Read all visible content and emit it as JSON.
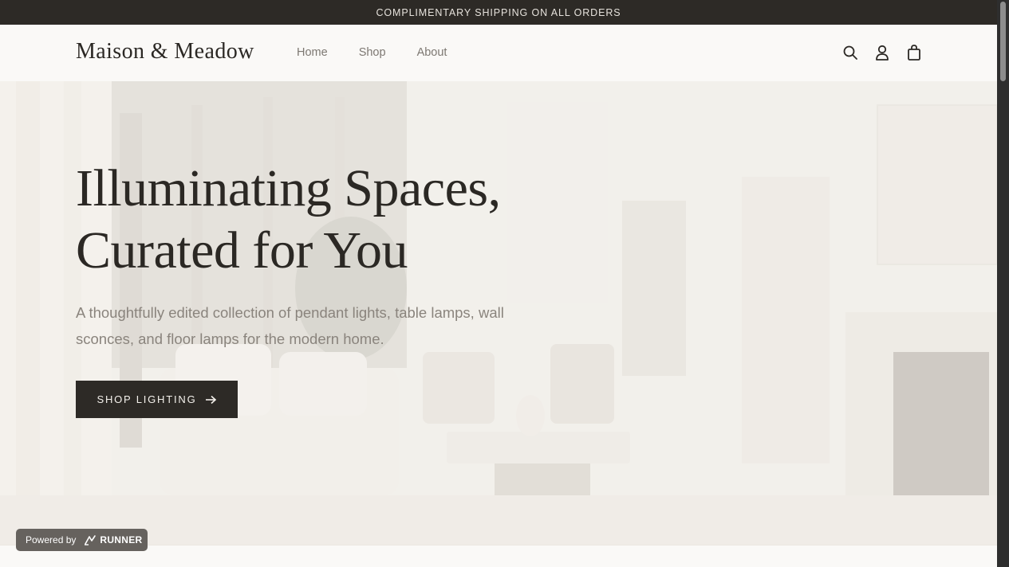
{
  "announcement": "COMPLIMENTARY SHIPPING ON ALL ORDERS",
  "header": {
    "logo": "Maison & Meadow",
    "nav": [
      "Home",
      "Shop",
      "About"
    ],
    "icons": [
      "search-icon",
      "account-icon",
      "cart-icon"
    ]
  },
  "hero": {
    "title_line1": "Illuminating Spaces,",
    "title_line2": "Curated for You",
    "subtitle": "A thoughtfully edited collection of pendant lights, table lamps, wall sconces, and floor lamps for the modern home.",
    "cta_label": "SHOP LIGHTING",
    "cta_icon": "arrow-right-icon"
  },
  "badge": {
    "prefix": "Powered by",
    "brand": "RUNNER",
    "icon": "runner-logo-icon"
  },
  "colors": {
    "dark": "#2d2a26",
    "background": "#f8f6f3",
    "muted_text": "#8a847d"
  }
}
